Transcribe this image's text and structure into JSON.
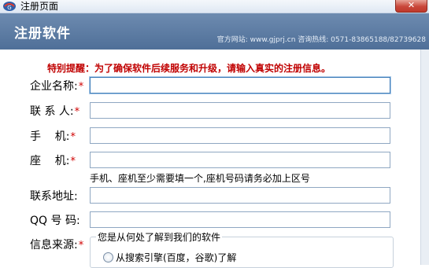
{
  "window": {
    "title": "注册页面",
    "close_label": "✕"
  },
  "banner": {
    "title": "注册软件",
    "contact": "官方网站: www.gjprj.cn 咨询热线: 0571-83865188/82739628"
  },
  "notice": "特别提醒：为了确保软件后续服务和升级，请输入真实的注册信息。",
  "form": {
    "company_label": "企业名称:",
    "contact_label": "联 系 人:",
    "mobile_label": "手    机:",
    "phone_label": "座    机:",
    "address_label": "联系地址:",
    "qq_label": "QQ 号 码:",
    "source_label": "信息来源:",
    "required_mark": "*",
    "company_value": "",
    "contact_value": "",
    "mobile_value": "",
    "phone_value": "",
    "address_value": "",
    "qq_value": ""
  },
  "hint": "手机、座机至少需要填一个,座机号码请务必加上区号",
  "source_group": {
    "legend": "您是从何处了解到我们的软件",
    "option_1": "从搜索引擎(百度，谷歌)了解"
  }
}
